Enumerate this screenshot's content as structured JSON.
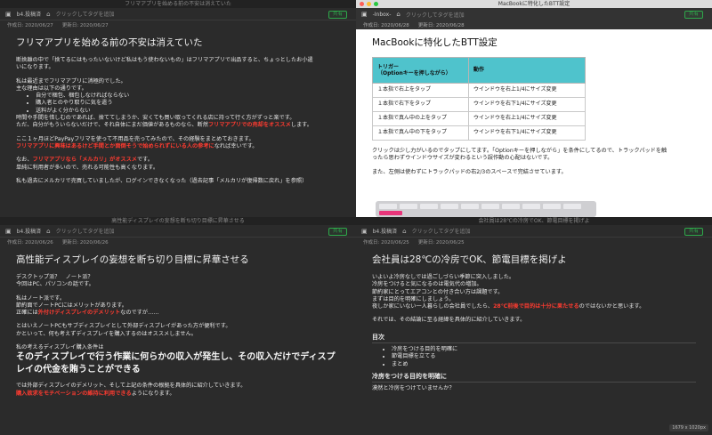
{
  "top_left": {
    "window_title": "フリマアプリを始める前の不安は消えていた",
    "notebook": "b4.投稿済",
    "tag_hint": "クリックしてタグを追加",
    "share_label": "共有",
    "created": "作成日: 2020/06/27",
    "updated": "更新日: 2020/06/27",
    "title": "フリマアプリを始める前の不安は消えていた",
    "lines": [
      "断捨離の中で「捨てるにはもったいないけど私はもう使わないもの」はフリマアプリで出品すると、ちょっとしたお小遣",
      "いになります。",
      "私は最近までフリマアプリに消極的でした。",
      "主な理由は以下の通りです。"
    ],
    "bullets": [
      "自分で梱包、梱包しなければならない",
      "購入者とのやり取りに気を遣う",
      "送料がよく分からない"
    ],
    "lines2a": "時間や手間を惜しむのであれば、捨ててしまうか、安くても買い取ってくれる店に持って行く方がずっと楽です。",
    "lines2b_prefix": "ただ、自分がもういらないだけで、それ自体にまだ価値があるものなら、断然",
    "lines2b_red": "フリマアプリでの売却をオススメ",
    "lines2b_suffix": "します。",
    "lines3": "ここ１ヶ月ほどPayPayフリマを使って不用品を売ってみたので、その経験をまとめておきます。",
    "lines3_red": "フリマアプリに興味はあるけど手間とか面倒そうで始められずにいる人の参考に",
    "lines3_suffix": "なれば幸いです。",
    "lines4_prefix": "なお、",
    "lines4_red": "フリマアプリなら「メルカリ」がオススメ",
    "lines4_suffix": "です。",
    "lines5": "単純に利用者が多いので、売れる可能性も高くなります。",
    "lines6": "私も過去にメルカリで売買していましたが、ログインできなくなった（過去記事「メルカリが復帰数に戻れ」を参照）"
  },
  "top_right": {
    "window_title": "MacBookに特化したBTT設定",
    "notebook": "-Inbox-",
    "tag_hint": "クリックしてタグを追加",
    "share_label": "共有",
    "created": "作成日: 2020/06/28",
    "updated": "更新日: 2020/06/28",
    "title": "MacBookに特化したBTT設定",
    "table_header": [
      "トリガー\n（Optionキーを押しながら）",
      "動作"
    ],
    "table_rows": [
      [
        "１本指で右上をタップ",
        "ウインドウを右上1/4にサイズ変更"
      ],
      [
        "１本指で右下をタップ",
        "ウインドウを右下1/4にサイズ変更"
      ],
      [
        "１本指で真ん中の上をタップ",
        "ウインドウを右上1/4にサイズ変更"
      ],
      [
        "１本指で真ん中の下をタップ",
        "ウインドウを右下1/4にサイズ変更"
      ]
    ],
    "para1": "クリックは少し力がいるのでタップにしてます。「Optionキーを押しながら」を条件にしてるので、トラックパッドを触",
    "para1b": "ったら思わずウインドウサイズが変わるという誤作動の心配はないです。",
    "para2": "また、左側は使わずにトラックパッドの右2/3のスペースで完結させています。"
  },
  "bottom_left": {
    "window_title": "高性能ディスプレイの妄想を断ち切り目標に昇華させる",
    "notebook": "b4.投稿済",
    "tag_hint": "クリックしてタグを追加",
    "share_label": "共有",
    "created": "作成日: 2020/06/26",
    "updated": "更新日: 2020/06/26",
    "title": "高性能ディスプレイの妄想を断ち切り目標に昇華させる",
    "lines": [
      "デスクトップ派？　ノート派？",
      "今回はPC、パソコンの話です。"
    ],
    "lines2": [
      "私はノート派です。",
      "節約面でノートPCにはメリットがあります。"
    ],
    "line_red_prefix": "正確には",
    "line_red": "外付けディスプレイのデメリット",
    "line_red_suffix": "なのですが……",
    "lines3": [
      "とはいえノートPCもサブディスプレイとして外部ディスプレイがあった方が便利です。",
      "かといって、何も考えずディスプレイを購入するのはオススメしません。"
    ],
    "lines4": "私の考えるディスプレイ購入条件は",
    "big": "そのディスプレイで行う作業に何らかの収入が発生し、その収入だけでディスプレイの代金を賄うことができる",
    "lines5": "では外部ディスプレイのデメリット、そして上記の条件の根拠を具体的に紹介していきます。",
    "lines6_red": "購入欲求をモチベーションの維持に利用できる",
    "lines6_suffix": "ようになります。"
  },
  "bottom_right": {
    "window_title": "会社員は28℃の冷房でOK、節電目標を掲げよ",
    "notebook": "b4.投稿済",
    "tag_hint": "クリックしてタグを追加",
    "share_label": "共有",
    "created": "作成日: 2020/06/25",
    "updated": "更新日: 2020/06/25",
    "title": "会社員は28℃の冷房でOK、節電目標を掲げよ",
    "lines": [
      "いよいよ冷房なしでは過ごしづらい季節に突入しました。",
      "冷房をつけると気になるのは電気代の増加。",
      "節約家にとってエアコンとの付き合い方は課題です。",
      "まずは目的を明確にしましょう。"
    ],
    "line5_prefix": "夜しか家にいない一人暮らしの会社員でしたら、",
    "line5_red": "28℃前後で目的は十分に果たせる",
    "line5_suffix": "のではないかと思います。",
    "line6": "それでは、その結論に至る経緯を具体的に紹介していきます。",
    "toc_heading": "目次",
    "toc": [
      "冷房をつける目的を明確に",
      "節電目標を立てる",
      "まとめ"
    ],
    "h2": "冷房をつける目的を明確に",
    "last": "漠然と冷房をつけていませんか？",
    "size_badge": "1679 x 1020px"
  }
}
